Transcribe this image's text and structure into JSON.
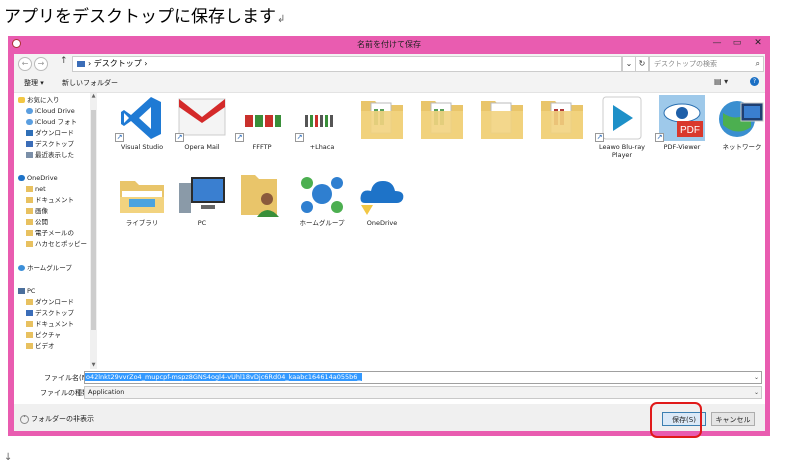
{
  "heading": {
    "text": "アプリをデスクトップに保存します",
    "return_mark": "↲"
  },
  "paragraph_mark": "↓",
  "dialog": {
    "title": "名前を付けて保存",
    "window_buttons": {
      "minimize": "—",
      "maximize": "▭",
      "close": "✕"
    }
  },
  "address_bar": {
    "back": "←",
    "forward": "→",
    "up": "↑",
    "path": [
      "デスクトップ"
    ],
    "separator": "›",
    "dropdown": "⌄",
    "refresh": "↻",
    "search_placeholder": "デスクトップの検索",
    "search_icon": "⌕"
  },
  "toolbar": {
    "organize": "整理 ▾",
    "new_folder": "新しいフォルダー",
    "view_icon": "▤ ▾",
    "help_icon": "?"
  },
  "nav_pane": {
    "items": [
      {
        "label": "お気に入り",
        "icon": "star-icon",
        "level": 0
      },
      {
        "label": "iCloud Drive",
        "icon": "cloud-icon",
        "level": 1
      },
      {
        "label": "iCloud フォト",
        "icon": "cloud-icon",
        "level": 1
      },
      {
        "label": "ダウンロード",
        "icon": "download-icon",
        "level": 1
      },
      {
        "label": "デスクトップ",
        "icon": "desktop-icon",
        "level": 1
      },
      {
        "label": "最近表示した",
        "icon": "recent-icon",
        "level": 1
      },
      {
        "label": "OneDrive",
        "icon": "onedrive-icon",
        "level": 0
      },
      {
        "label": "net",
        "icon": "folder-icon",
        "level": 1
      },
      {
        "label": "ドキュメント",
        "icon": "folder-icon",
        "level": 1
      },
      {
        "label": "画像",
        "icon": "folder-icon",
        "level": 1
      },
      {
        "label": "公開",
        "icon": "folder-icon",
        "level": 1
      },
      {
        "label": "電子メールの",
        "icon": "folder-icon",
        "level": 1
      },
      {
        "label": "ハカセとポッピー",
        "icon": "folder-icon",
        "level": 1
      },
      {
        "label": "ホームグループ",
        "icon": "homegroup-icon",
        "level": 0
      },
      {
        "label": "PC",
        "icon": "pc-icon",
        "level": 0
      },
      {
        "label": "ダウンロード",
        "icon": "download-icon",
        "level": 1
      },
      {
        "label": "デスクトップ",
        "icon": "desktop-icon",
        "level": 1
      },
      {
        "label": "ドキュメント",
        "icon": "documents-icon",
        "level": 1
      },
      {
        "label": "ピクチャ",
        "icon": "pictures-icon",
        "level": 1
      },
      {
        "label": "ビデオ",
        "icon": "video-icon",
        "level": 1
      }
    ]
  },
  "files": [
    {
      "label": "Visual Studio",
      "icon": "vscode-icon",
      "shortcut": true
    },
    {
      "label": "Opera Mail",
      "icon": "opera-mail-icon",
      "shortcut": true
    },
    {
      "label": "FFFTP",
      "icon": "ffftp-icon",
      "shortcut": true
    },
    {
      "label": "+Lhaca",
      "icon": "lhaca-icon",
      "shortcut": true
    },
    {
      "label": "",
      "icon": "folder-icon",
      "shortcut": false
    },
    {
      "label": "",
      "icon": "folder-icon",
      "shortcut": false
    },
    {
      "label": "",
      "icon": "folder-icon",
      "shortcut": false
    },
    {
      "label": "",
      "icon": "folder-icon",
      "shortcut": false
    },
    {
      "label": "Leawo Blu-ray Player",
      "icon": "leawo-icon",
      "shortcut": true
    },
    {
      "label": "PDF-Viewer",
      "icon": "pdf-viewer-icon",
      "shortcut": true
    },
    {
      "label": "ネットワーク",
      "icon": "network-icon",
      "shortcut": false
    },
    {
      "label": "ライブラリ",
      "icon": "libraries-icon",
      "shortcut": false
    },
    {
      "label": "PC",
      "icon": "pc-icon",
      "shortcut": false
    },
    {
      "label": "",
      "icon": "user-folder-icon",
      "shortcut": false
    },
    {
      "label": "ホームグループ",
      "icon": "homegroup-icon",
      "shortcut": false
    },
    {
      "label": "OneDrive",
      "icon": "onedrive-icon",
      "shortcut": false
    }
  ],
  "filename": {
    "label": "ファイル名(N):",
    "value": "o42lnkt29vvrZo4_mupcpf-mspz8GNS4ogl4-vUhl18vDjc6Rd04_kaabc164614a055b6_",
    "dropdown": "⌄"
  },
  "filetype": {
    "label": "ファイルの種類(T):",
    "value": "Application",
    "dropdown": "⌄"
  },
  "bottom": {
    "hide_folders": "フォルダーの非表示",
    "hide_chevron": "˄",
    "save": "保存(S)",
    "cancel": "キャンセル"
  },
  "colors": {
    "dialog_border": "#e95cb0",
    "highlight": "#e01a1a",
    "selection": "#3399ff"
  }
}
